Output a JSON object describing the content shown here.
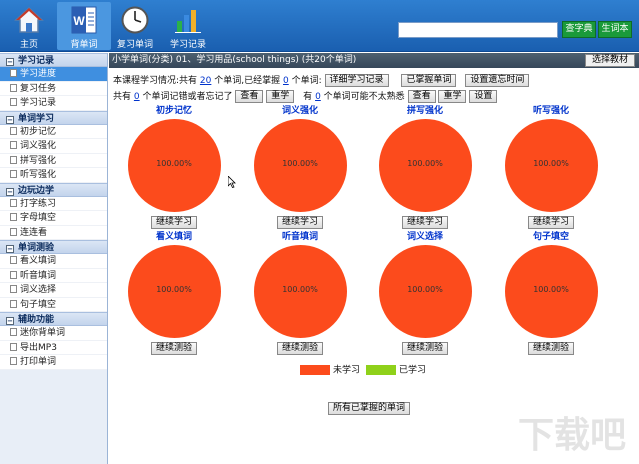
{
  "toolbar": {
    "tools": [
      {
        "label": "主页",
        "icon": "home-icon"
      },
      {
        "label": "背单词",
        "icon": "word-icon"
      },
      {
        "label": "复习单词",
        "icon": "clock-icon"
      },
      {
        "label": "学习记录",
        "icon": "bar-chart-icon"
      }
    ],
    "search_value": "",
    "lookup_button": "查字典",
    "wordbook_button": "生词本"
  },
  "sidebar": {
    "sections": [
      {
        "title": "学习记录",
        "items": [
          "学习进度",
          "复习任务",
          "学习记录"
        ]
      },
      {
        "title": "单词学习",
        "items": [
          "初步记忆",
          "词义强化",
          "拼写强化",
          "听写强化"
        ]
      },
      {
        "title": "边玩边学",
        "items": [
          "打字练习",
          "字母填空",
          "连连看"
        ]
      },
      {
        "title": "单词测验",
        "items": [
          "看义填词",
          "听音填词",
          "词义选择",
          "句子填空"
        ]
      },
      {
        "title": "辅助功能",
        "items": [
          "迷你背单词",
          "导出MP3",
          "打印单词"
        ]
      }
    ]
  },
  "main": {
    "title": "小学单词(分类) 01、学习用品(school things) (共20个单词)",
    "choose_button": "选择教材",
    "status1": {
      "p1": "本课程学习情况:共有",
      "total": "20",
      "p2": "个单词,已经掌握",
      "mastered": "0",
      "p3": "个单词:",
      "btn_detail": "详细学习记录",
      "btn_mastered": "已掌握单词",
      "btn_forget": "设置遗忘时间"
    },
    "status2": {
      "p1": "共有",
      "forgot": "0",
      "p2": "个单词记错或者忘记了",
      "btn_view": "查看",
      "btn_relearn": "重学",
      "p3": "有",
      "unfamiliar": "0",
      "p4": "个单词可能不太熟悉",
      "btn_view2": "查看",
      "btn_relearn2": "重学",
      "btn_set": "设置"
    },
    "cards": [
      {
        "title": "初步记忆",
        "percent": "100.00%",
        "button": "继续学习"
      },
      {
        "title": "词义强化",
        "percent": "100.00%",
        "button": "继续学习"
      },
      {
        "title": "拼写强化",
        "percent": "100.00%",
        "button": "继续学习"
      },
      {
        "title": "听写强化",
        "percent": "100.00%",
        "button": "继续学习"
      },
      {
        "title": "看义填词",
        "percent": "100.00%",
        "button": "继续测验"
      },
      {
        "title": "听音填词",
        "percent": "100.00%",
        "button": "继续测验"
      },
      {
        "title": "词义选择",
        "percent": "100.00%",
        "button": "继续测验"
      },
      {
        "title": "句子填空",
        "percent": "100.00%",
        "button": "继续测验"
      }
    ],
    "legend": {
      "unlearned_label": "未学习",
      "unlearned_color": "#fc4b1c",
      "learned_label": "已学习",
      "learned_color": "#8fd11a"
    },
    "all_mastered_button": "所有已掌握的单词"
  },
  "watermark": "下载吧"
}
